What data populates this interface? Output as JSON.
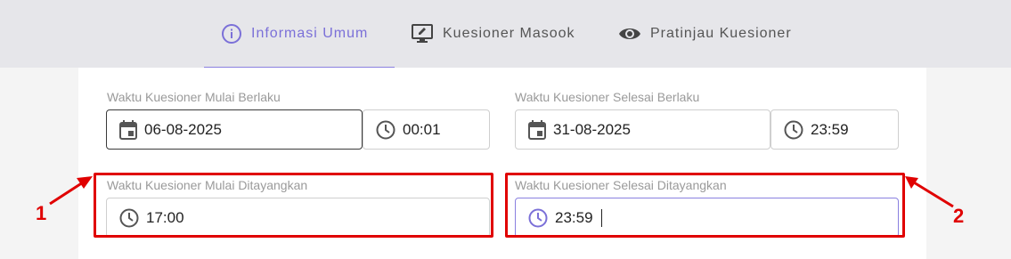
{
  "tabs": [
    {
      "label": "Informasi Umum",
      "icon": "info-icon",
      "active": true
    },
    {
      "label": "Kuesioner Masook",
      "icon": "monitor-edit-icon",
      "active": false
    },
    {
      "label": "Pratinjau Kuesioner",
      "icon": "eye-icon",
      "active": false
    }
  ],
  "fields": {
    "start_valid": {
      "label": "Waktu Kuesioner Mulai Berlaku",
      "date": "06-08-2025",
      "time": "00:01"
    },
    "end_valid": {
      "label": "Waktu Kuesioner Selesai Berlaku",
      "date": "31-08-2025",
      "time": "23:59"
    },
    "start_show": {
      "label": "Waktu Kuesioner Mulai Ditayangkan",
      "time": "17:00"
    },
    "end_show": {
      "label": "Waktu Kuesioner Selesai Ditayangkan",
      "time": "23:59"
    }
  },
  "annotations": {
    "one": "1",
    "two": "2"
  },
  "colors": {
    "accent": "#7b70d8",
    "highlight": "#e00000",
    "header_bg": "#e6e6ea"
  }
}
